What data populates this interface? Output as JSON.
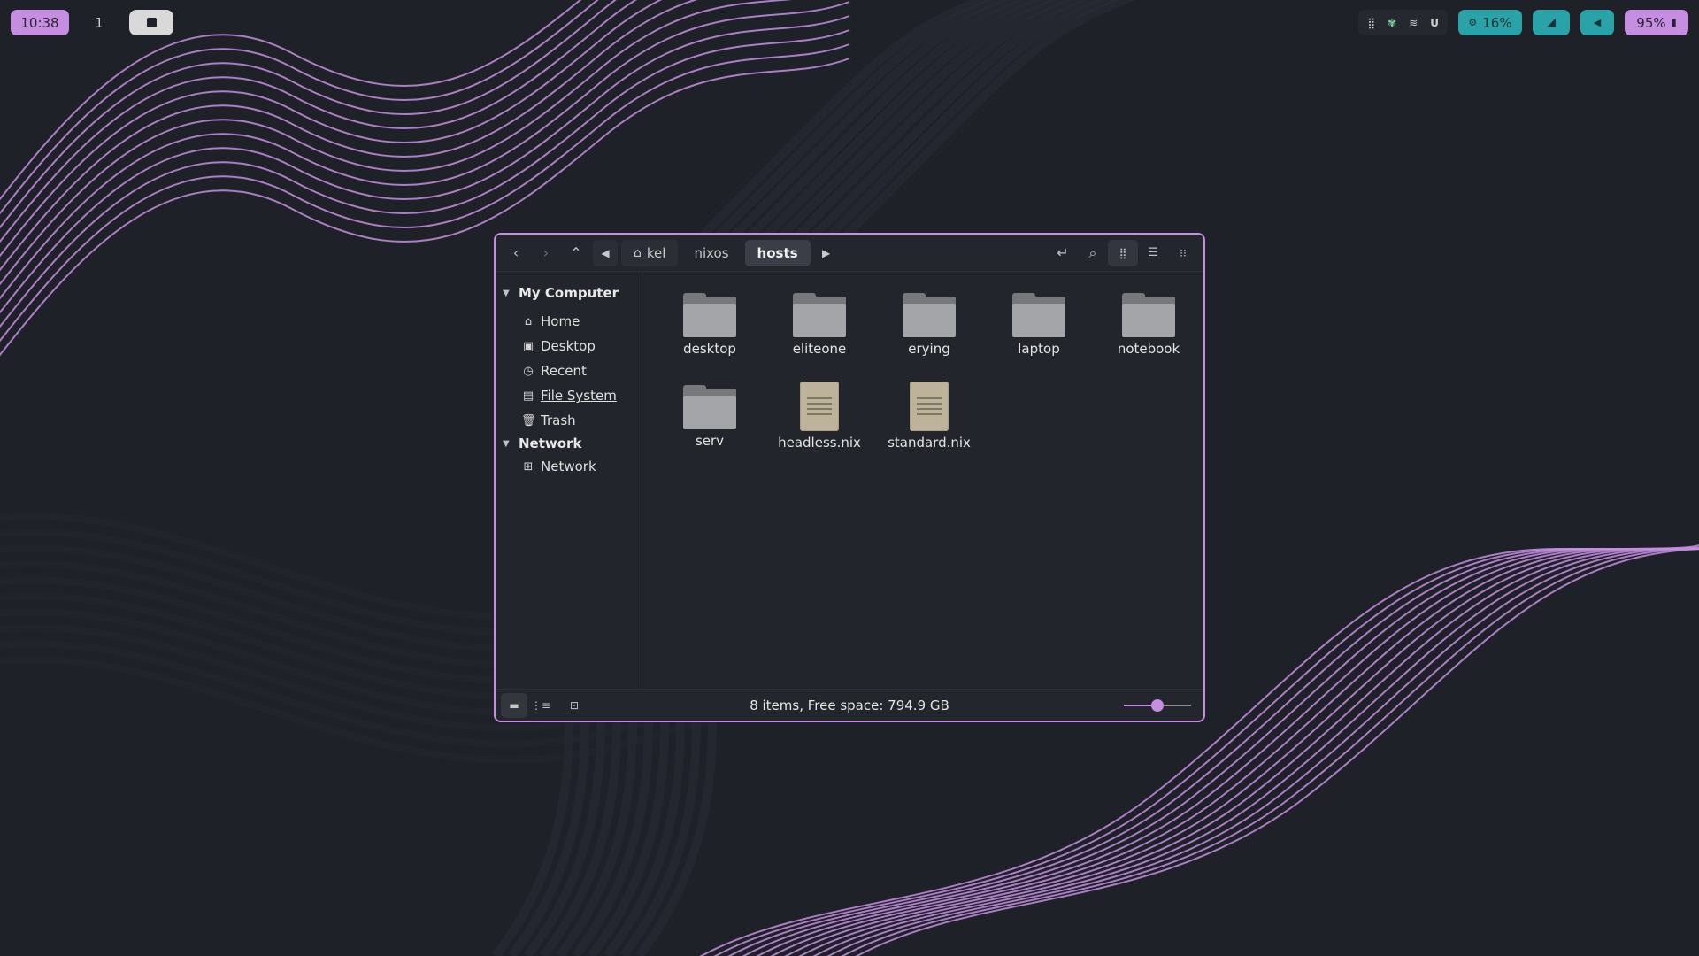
{
  "topbar": {
    "clock": "10:38",
    "workspace_number": "1",
    "cpu_label": "16%",
    "battery_label": "95%",
    "accent_color": "#c58ee0",
    "teal_color": "#2aa3a8"
  },
  "window": {
    "breadcrumbs": [
      {
        "label": "kel",
        "icon": "home-icon"
      },
      {
        "label": "nixos"
      },
      {
        "label": "hosts"
      }
    ],
    "sidebar": {
      "groups": [
        {
          "label": "My Computer",
          "items": [
            {
              "label": "Home",
              "icon": "home-icon"
            },
            {
              "label": "Desktop",
              "icon": "desktop-icon"
            },
            {
              "label": "Recent",
              "icon": "clock-icon"
            },
            {
              "label": "File System",
              "icon": "drive-icon"
            },
            {
              "label": "Trash",
              "icon": "trash-icon"
            }
          ]
        },
        {
          "label": "Network",
          "items": [
            {
              "label": "Network",
              "icon": "network-icon"
            }
          ]
        }
      ]
    },
    "files": [
      {
        "name": "desktop",
        "type": "folder"
      },
      {
        "name": "eliteone",
        "type": "folder"
      },
      {
        "name": "erying",
        "type": "folder"
      },
      {
        "name": "laptop",
        "type": "folder"
      },
      {
        "name": "notebook",
        "type": "folder"
      },
      {
        "name": "serv",
        "type": "folder"
      },
      {
        "name": "headless.nix",
        "type": "text-file"
      },
      {
        "name": "standard.nix",
        "type": "text-file"
      }
    ],
    "status_text": "8 items, Free space: 794.9 GB",
    "zoom_level": 0.5
  }
}
